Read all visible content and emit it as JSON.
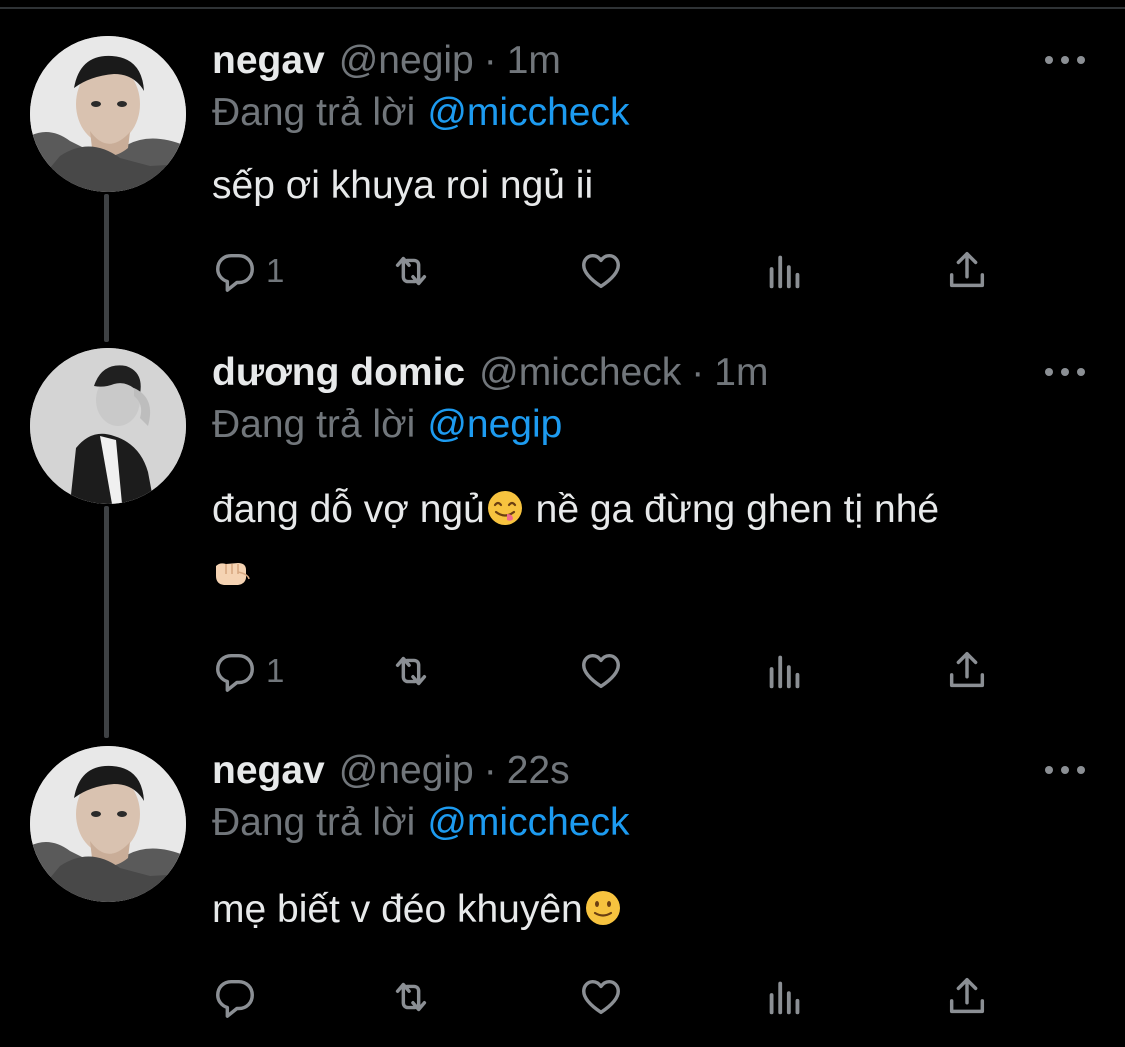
{
  "tweets": [
    {
      "name": "negav",
      "handle": "@negip",
      "dot": "·",
      "time": "1m",
      "reply_prefix": "Đang trả lời",
      "reply_mention": "@miccheck",
      "text_line1": "sếp ơi khuya roi ngủ ii",
      "reply_count": "1",
      "avatar": "negav-avatar"
    },
    {
      "name": "dương domic",
      "handle": "@miccheck",
      "dot": "·",
      "time": "1m",
      "reply_prefix": "Đang trả lời",
      "reply_mention": "@negip",
      "text_part1": "đang dỗ vợ ngủ",
      "text_part2": "  nề ga đừng ghen tị nhé",
      "emoji1": "face-savoring-food-emoji",
      "emoji2": "fist-pointing-emoji",
      "reply_count": "1",
      "avatar": "domic-avatar"
    },
    {
      "name": "negav",
      "handle": "@negip",
      "dot": "·",
      "time": "22s",
      "reply_prefix": "Đang trả lời",
      "reply_mention": "@miccheck",
      "text_line1": "mẹ biết v đéo khuyên",
      "emoji1": "slightly-smiling-face-emoji",
      "reply_count": "",
      "avatar": "negav-avatar"
    }
  ],
  "icons": {
    "reply": "reply-icon",
    "retweet": "retweet-icon",
    "like": "like-icon",
    "views": "views-icon",
    "share": "share-icon",
    "more": "more-icon"
  },
  "colors": {
    "background": "#000000",
    "text": "#e7e9ea",
    "secondary": "#71767b",
    "mention": "#1d9bf0",
    "thread_line": "#3e4144"
  }
}
